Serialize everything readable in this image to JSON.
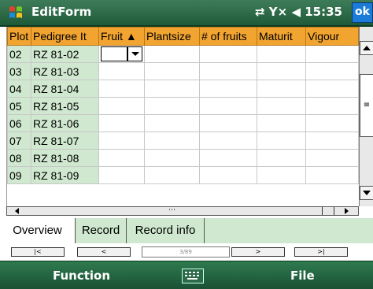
{
  "titlebar": {
    "title": "EditForm",
    "status": "⇄ Y× ◀ 15:35",
    "ok_label": "ok"
  },
  "grid": {
    "columns": [
      "Plot",
      "Pedigree It",
      "Fruit ▲",
      "Plantsize",
      "# of fruits",
      "Maturit",
      "Vigour"
    ],
    "rows": [
      {
        "plot": "02",
        "pedigree": "RZ 81-02"
      },
      {
        "plot": "03",
        "pedigree": "RZ 81-03"
      },
      {
        "plot": "04",
        "pedigree": "RZ 81-04"
      },
      {
        "plot": "05",
        "pedigree": "RZ 81-05"
      },
      {
        "plot": "06",
        "pedigree": "RZ 81-06"
      },
      {
        "plot": "07",
        "pedigree": "RZ 81-07"
      },
      {
        "plot": "08",
        "pedigree": "RZ 81-08"
      },
      {
        "plot": "09",
        "pedigree": "RZ 81-09"
      }
    ]
  },
  "tabs": [
    "Overview",
    "Record",
    "Record info"
  ],
  "nav": {
    "first": "|<",
    "prev": "<",
    "position": "3/89",
    "next": ">",
    "last": ">|"
  },
  "menubar": {
    "left": "Function",
    "right": "File"
  }
}
